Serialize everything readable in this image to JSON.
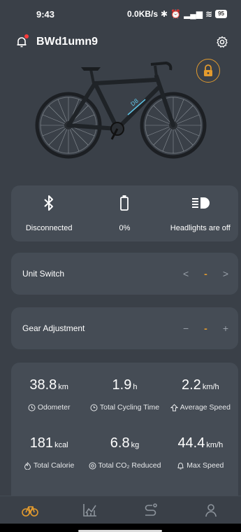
{
  "status_bar": {
    "time": "9:43",
    "network_speed": "0.0KB/s",
    "battery": "95"
  },
  "header": {
    "device_name": "BWd1umn9"
  },
  "status": {
    "bluetooth_label": "Disconnected",
    "battery_label": "0%",
    "headlight_label": "Headlights are off"
  },
  "unit_switch": {
    "label": "Unit Switch",
    "prev": "<",
    "value": "-",
    "next": ">"
  },
  "gear_adjustment": {
    "label": "Gear Adjustment",
    "minus": "−",
    "value": "-",
    "plus": "+"
  },
  "stats": [
    {
      "value": "38.8",
      "unit": "km",
      "caption": "Odometer"
    },
    {
      "value": "1.9",
      "unit": "h",
      "caption": "Total Cycling Time"
    },
    {
      "value": "2.2",
      "unit": "km/h",
      "caption": "Average Speed"
    },
    {
      "value": "181",
      "unit": "kcal",
      "caption": "Total Calorie"
    },
    {
      "value": "6.8",
      "unit": "kg",
      "caption": "Total CO₂ Reduced"
    },
    {
      "value": "44.4",
      "unit": "km/h",
      "caption": "Max Speed"
    }
  ],
  "colors": {
    "background": "#3a4048",
    "card": "#454c55",
    "accent": "#e39b2e",
    "notification_dot": "#ff3b3b"
  },
  "icons": {
    "tabs": [
      "bike-icon",
      "chart-icon",
      "route-icon",
      "profile-icon"
    ]
  }
}
